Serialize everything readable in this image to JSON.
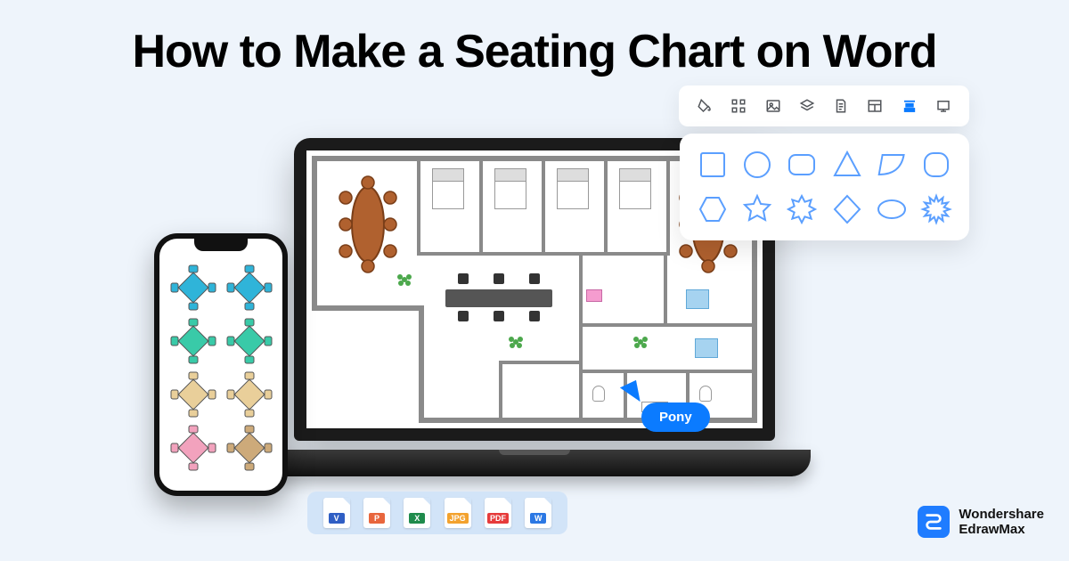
{
  "title": "How to Make a Seating Chart on Word",
  "cursor_label": "Pony",
  "toolbar": {
    "items": [
      "fill-icon",
      "nodes-icon",
      "image-icon",
      "layers-icon",
      "page-icon",
      "layout-icon",
      "align-icon",
      "present-icon"
    ],
    "active_index": 6
  },
  "shapes_panel": {
    "row1": [
      "rect",
      "circle",
      "roundrect",
      "triangle",
      "parallelogram",
      "roundsquare"
    ],
    "row2": [
      "hexagon",
      "star",
      "burst8",
      "diamond",
      "ellipse",
      "burst12"
    ]
  },
  "export_formats": [
    {
      "label": "V",
      "color": "#2f5ec4"
    },
    {
      "label": "P",
      "color": "#e8663d"
    },
    {
      "label": "X",
      "color": "#1f8b4c"
    },
    {
      "label": "JPG",
      "color": "#f3a22e"
    },
    {
      "label": "PDF",
      "color": "#e63b3b"
    },
    {
      "label": "W",
      "color": "#2b78e4"
    }
  ],
  "phone_seats": [
    {
      "color": "#2fb4d9"
    },
    {
      "color": "#2fb4d9"
    },
    {
      "color": "#39caa8"
    },
    {
      "color": "#39caa8"
    },
    {
      "color": "#e9cf9a"
    },
    {
      "color": "#e9cf9a"
    },
    {
      "color": "#f2a2bd"
    },
    {
      "color": "#cdaa7a"
    }
  ],
  "brand": {
    "line1": "Wondershare",
    "line2": "EdrawMax"
  }
}
